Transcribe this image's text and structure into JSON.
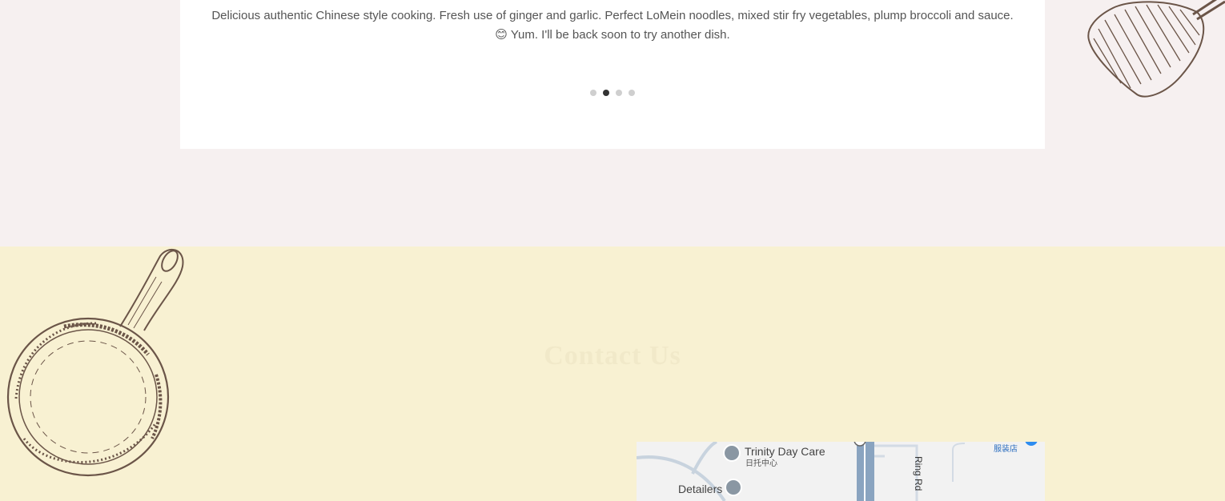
{
  "review": {
    "text_line1": "Delicious authentic Chinese style cooking. Fresh use of ginger and garlic. Perfect LoMein noodles, mixed stir fry vegetables, plump broccoli and sauce.",
    "text_line2": "😊 Yum. I'll be back soon to try another dish.",
    "carousel": {
      "total": 4,
      "active_index": 1
    }
  },
  "contact": {
    "heading": "Contact Us",
    "subheading": ""
  },
  "map": {
    "labels": {
      "trinity": "Trinity Day Care",
      "trinity_sub": "日托中心",
      "detailers": "Detailers",
      "ring_rd": "Ring Rd",
      "clothing_store": "服装店"
    }
  },
  "colors": {
    "review_bg": "#f6f0f0",
    "card_bg": "#ffffff",
    "contact_bg": "#f8f1d2",
    "sketch": "#6b5548"
  }
}
